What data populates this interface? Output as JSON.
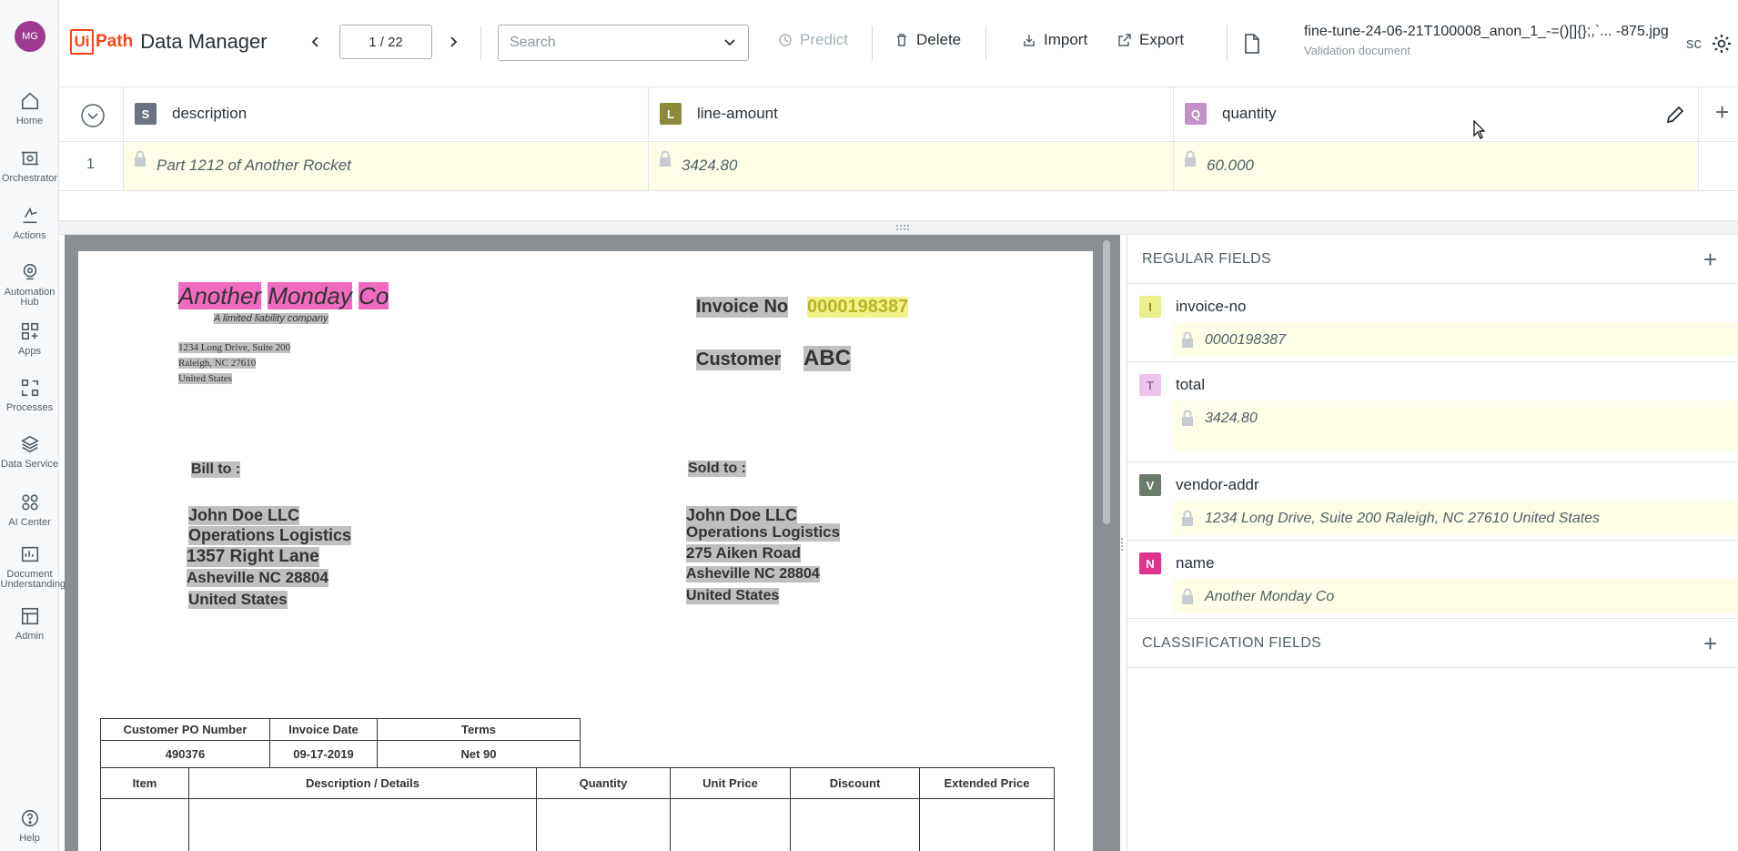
{
  "user": {
    "initials": "MG"
  },
  "nav": [
    {
      "label": "Home",
      "icon": "home-icon"
    },
    {
      "label": "Orchestrator",
      "icon": "orchestrator-icon"
    },
    {
      "label": "Actions",
      "icon": "actions-icon"
    },
    {
      "label": "Automation Hub",
      "icon": "automation-hub-icon"
    },
    {
      "label": "Apps",
      "icon": "apps-icon"
    },
    {
      "label": "Processes",
      "icon": "processes-icon"
    },
    {
      "label": "Data Service",
      "icon": "data-service-icon"
    },
    {
      "label": "AI Center",
      "icon": "ai-center-icon"
    },
    {
      "label": "Document Understanding",
      "icon": "document-understanding-icon"
    },
    {
      "label": "Admin",
      "icon": "admin-icon"
    }
  ],
  "help_label": "Help",
  "header": {
    "logo_ui": "Ui",
    "logo_path": "Path",
    "app_title": "Data Manager",
    "pager": "1 / 22",
    "search_placeholder": "Search",
    "predict_label": "Predict",
    "delete_label": "Delete",
    "import_label": "Import",
    "export_label": "Export",
    "file_name": "fine-tune-24-06-21T100008_anon_1_-=()[]{};,`... -875.jpg",
    "file_sub": "Validation document",
    "user_short": "sc"
  },
  "table": {
    "columns": [
      {
        "badge": "S",
        "name": "description",
        "color": "#6b7280"
      },
      {
        "badge": "L",
        "name": "line-amount",
        "color": "#8a8a3a"
      },
      {
        "badge": "Q",
        "name": "quantity",
        "color": "#c58fc8"
      }
    ],
    "rows": [
      {
        "index": "1",
        "values": [
          "Part 1212 of Another Rocket",
          "3424.80",
          "60.000"
        ]
      }
    ]
  },
  "document": {
    "company": [
      "Another",
      "Monday",
      "Co"
    ],
    "tagline": "A limited liability company",
    "address": [
      "1234 Long Drive, Suite 200",
      "Raleigh, NC 27610",
      "United States"
    ],
    "invoice_no_label": "Invoice No",
    "invoice_no": "0000198387",
    "customer_label": "Customer",
    "customer": "ABC",
    "bill_to_label": "Bill to :",
    "bill_to": [
      "John Doe LLC",
      "Operations Logistics",
      "1357 Right Lane",
      "Asheville NC 28804",
      "United States"
    ],
    "sold_to_label": "Sold to :",
    "sold_to": [
      "John Doe LLC",
      "Operations Logistics",
      "275 Aiken Road",
      "Asheville NC 28804",
      "United States"
    ],
    "meta_headers": [
      "Customer PO Number",
      "Invoice Date",
      "Terms"
    ],
    "meta_values": [
      "490376",
      "09-17-2019",
      "Net 90"
    ],
    "item_headers": [
      "Item",
      "Description / Details",
      "Quantity",
      "Unit Price",
      "Discount",
      "Extended Price"
    ]
  },
  "regular_fields_title": "REGULAR FIELDS",
  "classification_fields_title": "CLASSIFICATION FIELDS",
  "fields": [
    {
      "badge": "I",
      "name": "invoice-no",
      "value": "0000198387",
      "badge_bg": "#e9ef8a",
      "badge_fg": "#8a8a3a"
    },
    {
      "badge": "T",
      "name": "total",
      "value": "3424.80",
      "badge_bg": "#ecc6e8",
      "badge_fg": "#9d6b9a"
    },
    {
      "badge": "V",
      "name": "vendor-addr",
      "value": "1234 Long Drive, Suite 200 Raleigh, NC 27610 United States",
      "badge_bg": "#6b7a6b",
      "badge_fg": "#ffffff"
    },
    {
      "badge": "N",
      "name": "name",
      "value": "Another Monday Co",
      "badge_bg": "#e0338b",
      "badge_fg": "#ffffff"
    }
  ]
}
